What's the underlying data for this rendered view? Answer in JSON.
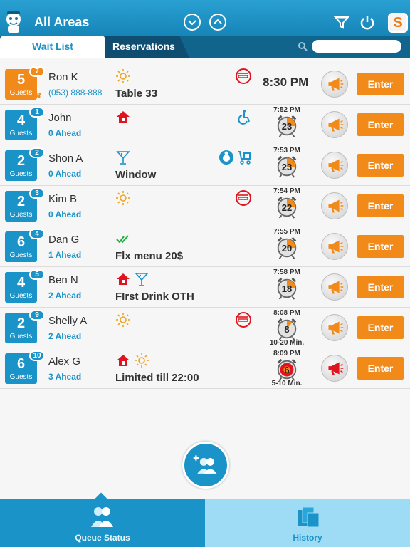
{
  "header": {
    "title": "All Areas",
    "brand_letter": "S",
    "icons": [
      "mascot-logo",
      "chevron-down-icon",
      "chevron-up-icon",
      "filter-icon",
      "power-icon"
    ]
  },
  "tabs": [
    {
      "label": "Wait List",
      "selected": true
    },
    {
      "label": "Reservations",
      "selected": false
    }
  ],
  "search": {
    "placeholder": ""
  },
  "colors": {
    "brand": "#1a93c9",
    "accent": "#f28a1a",
    "header_dark": "#11648c"
  },
  "waitlist": [
    {
      "guests": "5",
      "guests_label": "Guests",
      "queue": "7",
      "name": "Ron K",
      "sub": "(053) 888-888",
      "note": "Table 33",
      "icons": [
        "sun-icon"
      ],
      "right_icon": "no-smoking-icon",
      "time": "8:30 PM",
      "enter": "Enter"
    },
    {
      "guests": "4",
      "guests_label": "Guests",
      "queue": "1",
      "name": "John",
      "sub": "0 Ahead",
      "note": "",
      "icons": [
        "home-icon"
      ],
      "right_icon": "wheelchair-icon",
      "time": "7:52 PM",
      "minutes": "23",
      "enter": "Enter"
    },
    {
      "guests": "2",
      "guests_label": "Guests",
      "queue": "2",
      "name": "Shon A",
      "sub": "0 Ahead",
      "note": "Window",
      "icons": [
        "cocktail-icon"
      ],
      "right_icon": "baby-stroller-icons",
      "time": "7:53 PM",
      "minutes": "23",
      "enter": "Enter"
    },
    {
      "guests": "2",
      "guests_label": "Guests",
      "queue": "3",
      "name": "Kim B",
      "sub": "0 Ahead",
      "note": "",
      "icons": [
        "sun-icon"
      ],
      "right_icon": "no-smoking-icon",
      "time": "7:54 PM",
      "minutes": "22",
      "enter": "Enter"
    },
    {
      "guests": "6",
      "guests_label": "Guests",
      "queue": "4",
      "name": "Dan G",
      "sub": "1 Ahead",
      "note": "Flx menu 20$",
      "icons": [
        "double-check-icon"
      ],
      "right_icon": "",
      "time": "7:55 PM",
      "minutes": "20",
      "enter": "Enter"
    },
    {
      "guests": "4",
      "guests_label": "Guests",
      "queue": "5",
      "name": "Ben N",
      "sub": "2 Ahead",
      "note": "FIrst Drink OTH",
      "icons": [
        "home-icon",
        "cocktail-icon"
      ],
      "right_icon": "",
      "time": "7:58 PM",
      "minutes": "18",
      "enter": "Enter"
    },
    {
      "guests": "2",
      "guests_label": "Guests",
      "queue": "9",
      "name": "Shelly A",
      "sub": "2 Ahead",
      "note": "",
      "icons": [
        "sun-icon"
      ],
      "right_icon": "no-smoking-icon",
      "time": "8:08 PM",
      "minutes": "8",
      "estimate": "10-20 Min.",
      "enter": "Enter"
    },
    {
      "guests": "6",
      "guests_label": "Guests",
      "queue": "10",
      "name": "Alex G",
      "sub": "3 Ahead",
      "note": "Limited till 22:00",
      "icons": [
        "home-icon",
        "sun-icon"
      ],
      "right_icon": "",
      "time": "8:09 PM",
      "minutes": "6",
      "estimate": "5-10 Min.",
      "enter": "Enter"
    }
  ],
  "bottom_nav": [
    {
      "label": "Queue Status",
      "selected": true
    },
    {
      "label": "History",
      "selected": false
    }
  ]
}
